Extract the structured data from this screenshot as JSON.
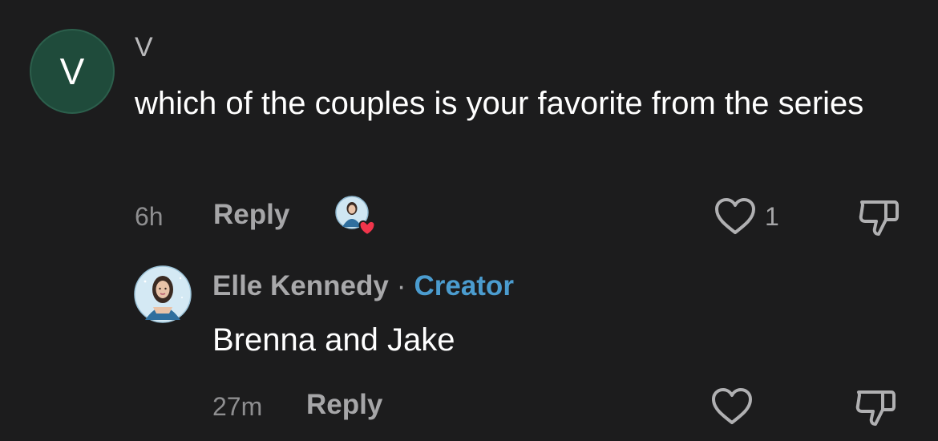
{
  "comment": {
    "avatar_letter": "V",
    "username": "V",
    "text": "which of the couples is your favorite from the series",
    "time": "6h",
    "reply_label": "Reply",
    "like_count": "1"
  },
  "reply": {
    "username": "Elle Kennedy",
    "separator": "·",
    "badge": "Creator",
    "text": "Brenna and Jake",
    "time": "27m",
    "reply_label": "Reply"
  },
  "colors": {
    "background": "#1c1c1d",
    "avatar_green": "#1f4b3b",
    "creator_blue": "#4b9ccf",
    "heart_red": "#f0354b"
  },
  "icons": {
    "like": "heart-outline-icon",
    "dislike": "thumbs-down-icon",
    "creator_liked": "creator-heart-badge-icon"
  }
}
